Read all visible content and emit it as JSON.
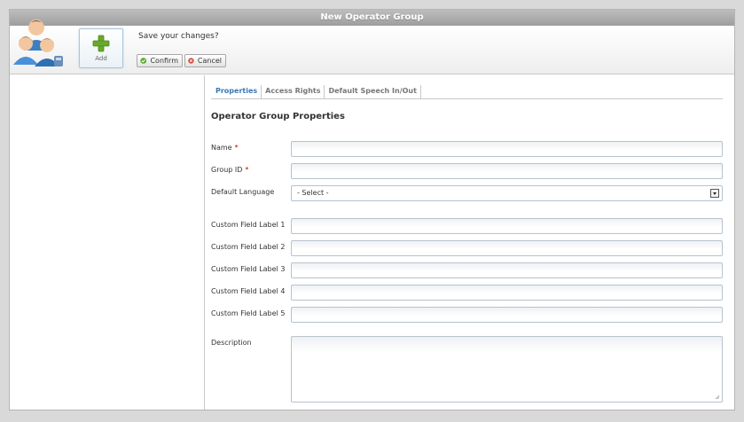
{
  "window": {
    "title": "New Operator Group"
  },
  "toolbar": {
    "add_label": "Add",
    "prompt": "Save your changes?",
    "confirm_label": "Confirm",
    "cancel_label": "Cancel"
  },
  "tabs": [
    {
      "label": "Properties",
      "active": true
    },
    {
      "label": "Access Rights",
      "active": false
    },
    {
      "label": "Default Speech In/Out",
      "active": false
    }
  ],
  "form": {
    "title": "Operator Group Properties",
    "required_mark": "*",
    "name": {
      "label": "Name",
      "value": ""
    },
    "group_id": {
      "label": "Group ID",
      "value": ""
    },
    "default_language": {
      "label": "Default Language",
      "selected": "- Select -"
    },
    "custom1": {
      "label": "Custom Field Label 1",
      "value": ""
    },
    "custom2": {
      "label": "Custom Field Label 2",
      "value": ""
    },
    "custom3": {
      "label": "Custom Field Label 3",
      "value": ""
    },
    "custom4": {
      "label": "Custom Field Label 4",
      "value": ""
    },
    "custom5": {
      "label": "Custom Field Label 5",
      "value": ""
    },
    "description": {
      "label": "Description",
      "value": ""
    }
  },
  "icons": {
    "logo": "operator-group-icon",
    "add": "plus-icon",
    "confirm": "check-circle-icon",
    "cancel": "x-circle-icon",
    "dropdown": "chevron-down-icon"
  },
  "colors": {
    "accent": "#3a78b5",
    "confirm": "#5cb030",
    "cancel": "#d24a3a",
    "add": "#6aa82c",
    "required": "#cc0000"
  }
}
